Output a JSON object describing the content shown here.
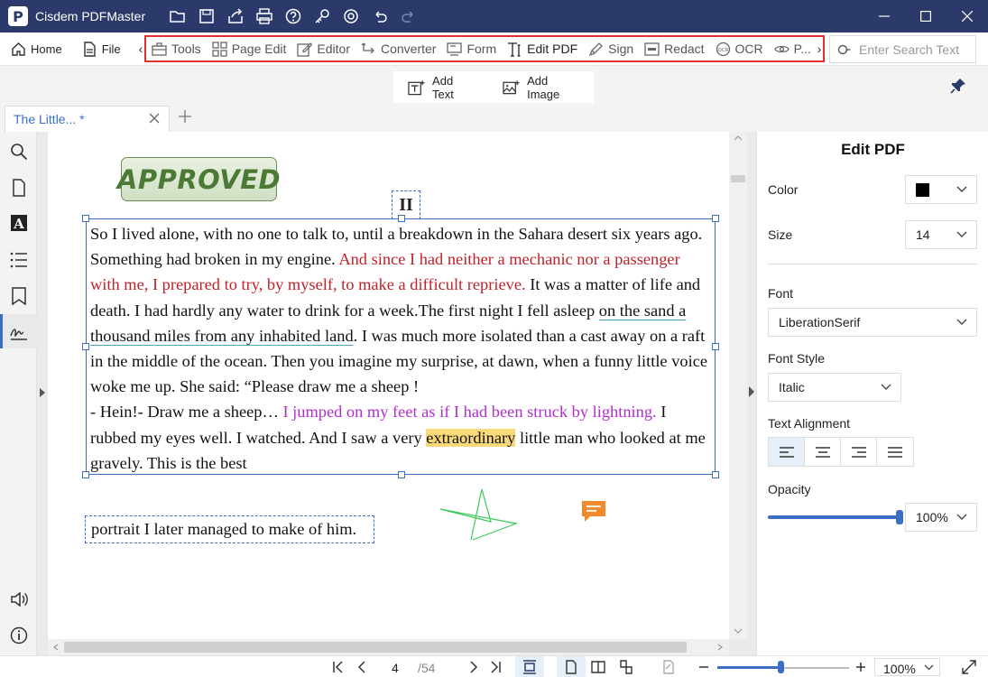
{
  "app": {
    "title": "Cisdem PDFMaster",
    "logo_letter": "P"
  },
  "toolbar": {
    "home": "Home",
    "file": "File",
    "tools": [
      {
        "label": "Tools",
        "icon": "toolbox-icon"
      },
      {
        "label": "Page Edit",
        "icon": "grid-icon"
      },
      {
        "label": "Editor",
        "icon": "edit-icon"
      },
      {
        "label": "Converter",
        "icon": "convert-icon"
      },
      {
        "label": "Form",
        "icon": "form-icon"
      },
      {
        "label": "Edit PDF",
        "icon": "text-cursor-icon"
      },
      {
        "label": "Sign",
        "icon": "pen-icon"
      },
      {
        "label": "Redact",
        "icon": "redact-icon"
      },
      {
        "label": "OCR",
        "icon": "ocr-icon"
      },
      {
        "label": "P...",
        "icon": "eye-icon"
      }
    ],
    "search_placeholder": "Enter Search Text"
  },
  "subtoolbar": {
    "add_text": "Add Text",
    "add_image": "Add Image"
  },
  "tab": {
    "label": "The Little... *"
  },
  "document": {
    "stamp": "APPROVED",
    "chapter": "II",
    "paragraph": {
      "s1": "So I lived alone, with no one to talk to, until a breakdown in the Sahara desert six years ago. Something had broken in my engine. ",
      "s2_red": "And since I had neither a mechanic nor a passenger with me, I prepared to try, by myself, to make a difficult reprieve.",
      "s3": " It was a matter of life and death. I had hardly any water to drink for a week.The first night I fell asleep ",
      "s4_underline": "on the sand a thousand miles from any inhabited land",
      "s5": ". I was much more isolated than a cast away on a raft in the middle of the ocean. Then you imagine my surprise, at dawn, when a funny little voice woke me up. She said: “Please draw me a sheep !",
      "s6": "- Hein!- Draw me a sheep… ",
      "s7_purple": "I jumped on my feet as if I had been struck by lightning.",
      "s8": " I rubbed my eyes well. I watched. And I saw a very ",
      "s9_highlight": "extraordinary",
      "s10": " little man who looked at me gravely. This is the best"
    },
    "continuation": "portrait I later managed to make of him."
  },
  "panel": {
    "title": "Edit PDF",
    "color_label": "Color",
    "color_value": "#000000",
    "size_label": "Size",
    "size_value": "14",
    "font_label": "Font",
    "font_value": "LiberationSerif",
    "font_style_label": "Font Style",
    "font_style_value": "Italic",
    "alignment_label": "Text Alignment",
    "alignment_selected": "left",
    "opacity_label": "Opacity",
    "opacity_value": "100%"
  },
  "status": {
    "page_current": "4",
    "page_total": "/54",
    "zoom": "100%",
    "zoom_fraction": 0.48
  },
  "colors": {
    "accent": "#3a6fc4",
    "titlebar": "#2b3a6b",
    "highlight_box": "#e03030",
    "red_text": "#c0222a",
    "purple_text": "#b02fcc"
  }
}
